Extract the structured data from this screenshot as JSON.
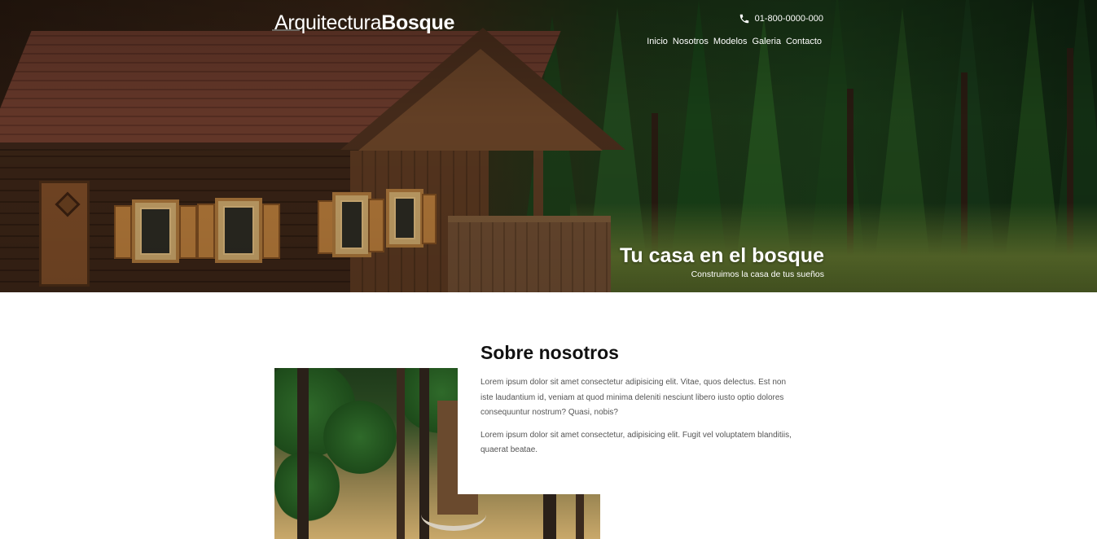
{
  "header": {
    "brand_light": "Arquitectura",
    "brand_bold": "Bosque",
    "phone": "01-800-0000-000",
    "phone_icon": "phone-icon",
    "nav": [
      {
        "label": "Inicio"
      },
      {
        "label": "Nosotros"
      },
      {
        "label": "Modelos"
      },
      {
        "label": "Galeria"
      },
      {
        "label": "Contacto"
      }
    ]
  },
  "hero": {
    "title": "Tu casa en el bosque",
    "subtitle": "Construimos la casa de tus sueños"
  },
  "about": {
    "title": "Sobre nosotros",
    "paragraphs": [
      "Lorem ipsum dolor sit amet consectetur adipisicing elit. Vitae, quos delectus. Est non iste laudantium id, veniam at quod minima deleniti nesciunt libero iusto optio dolores consequuntur nostrum? Quasi, nobis?",
      "Lorem ipsum dolor sit amet consectetur, adipisicing elit. Fugit vel voluptatem blanditiis, quaerat beatae."
    ]
  },
  "colors": {
    "text_dark": "#111111",
    "text_body": "#555555",
    "hero_text": "#ffffff"
  }
}
